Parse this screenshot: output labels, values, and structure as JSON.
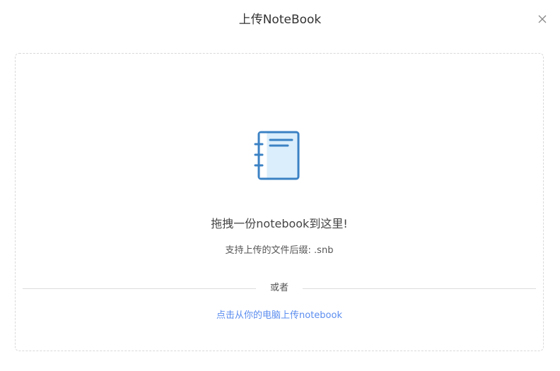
{
  "dialog": {
    "title": "上传NoteBook"
  },
  "dropzone": {
    "icon": "notebook-icon",
    "drop_text": "拖拽一份notebook到这里!",
    "hint_text": "支持上传的文件后缀: .snb",
    "divider_text": "或者",
    "upload_link": "点击从你的电脑上传notebook"
  },
  "icons": {
    "close": "close-icon"
  },
  "colors": {
    "accent": "#5b8def",
    "icon_stroke": "#3b82c4",
    "icon_fill": "#dbeefb",
    "border": "#d9d9d9"
  }
}
